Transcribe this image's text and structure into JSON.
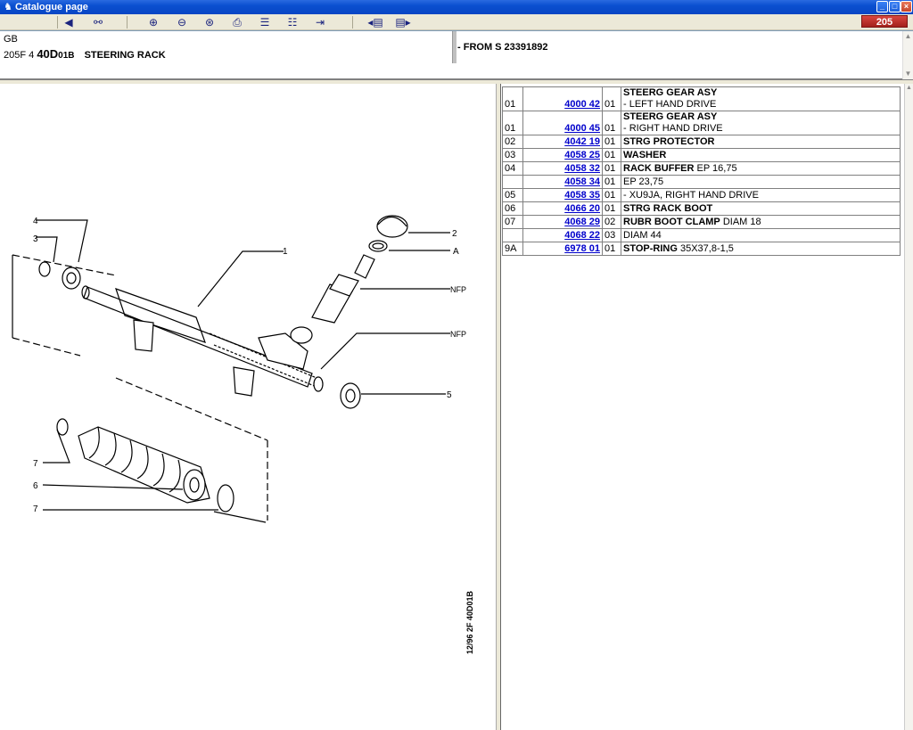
{
  "window": {
    "title": "Catalogue page",
    "controls": [
      "_",
      "□",
      "×"
    ]
  },
  "toolbar": {
    "model_badge": "205"
  },
  "header": {
    "language": "GB",
    "model_code": "205F 4",
    "group_big": "40D",
    "group_sub": "01B",
    "group_name": "STEERING RACK",
    "from_text": "- FROM S 23391892"
  },
  "diagram": {
    "labels": {
      "l1": "1",
      "l2": "2",
      "l3": "3",
      "l4": "4",
      "l5": "5",
      "l6": "6",
      "l7a": "7",
      "l7b": "7",
      "la": "A",
      "nfp1": "NFP",
      "nfp2": "NFP"
    },
    "ref_code": "12/96 2F 40D01B"
  },
  "parts": [
    {
      "ref": "01",
      "part": "4000 42",
      "qty": "01",
      "desc_bold": "STEERG GEAR ASY",
      "desc": "",
      "desc2": "- LEFT HAND DRIVE"
    },
    {
      "ref": "01",
      "part": "4000 45",
      "qty": "01",
      "desc_bold": "STEERG GEAR ASY",
      "desc": "",
      "desc2": "- RIGHT HAND DRIVE"
    },
    {
      "ref": "02",
      "part": "4042 19",
      "qty": "01",
      "desc_bold": "STRG PROTECTOR",
      "desc": "",
      "desc2": ""
    },
    {
      "ref": "03",
      "part": "4058 25",
      "qty": "01",
      "desc_bold": "WASHER",
      "desc": "",
      "desc2": ""
    },
    {
      "ref": "04",
      "part": "4058 32",
      "qty": "01",
      "desc_bold": "RACK BUFFER",
      "desc": " EP 16,75",
      "desc2": ""
    },
    {
      "ref": "",
      "part": "4058 34",
      "qty": "01",
      "desc_bold": "",
      "desc": "EP 23,75",
      "desc2": ""
    },
    {
      "ref": "05",
      "part": "4058 35",
      "qty": "01",
      "desc_bold": "",
      "desc": "- XU9JA, RIGHT HAND DRIVE",
      "desc2": ""
    },
    {
      "ref": "06",
      "part": "4066 20",
      "qty": "01",
      "desc_bold": "STRG RACK BOOT",
      "desc": "",
      "desc2": ""
    },
    {
      "ref": "07",
      "part": "4068 29",
      "qty": "02",
      "desc_bold": "RUBR BOOT CLAMP",
      "desc": " DIAM 18",
      "desc2": ""
    },
    {
      "ref": "",
      "part": "4068 22",
      "qty": "03",
      "desc_bold": "",
      "desc": "DIAM 44",
      "desc2": ""
    },
    {
      "ref": "9A",
      "part": "6978 01",
      "qty": "01",
      "desc_bold": "STOP-RING",
      "desc": " 35X37,8-1,5",
      "desc2": ""
    }
  ]
}
